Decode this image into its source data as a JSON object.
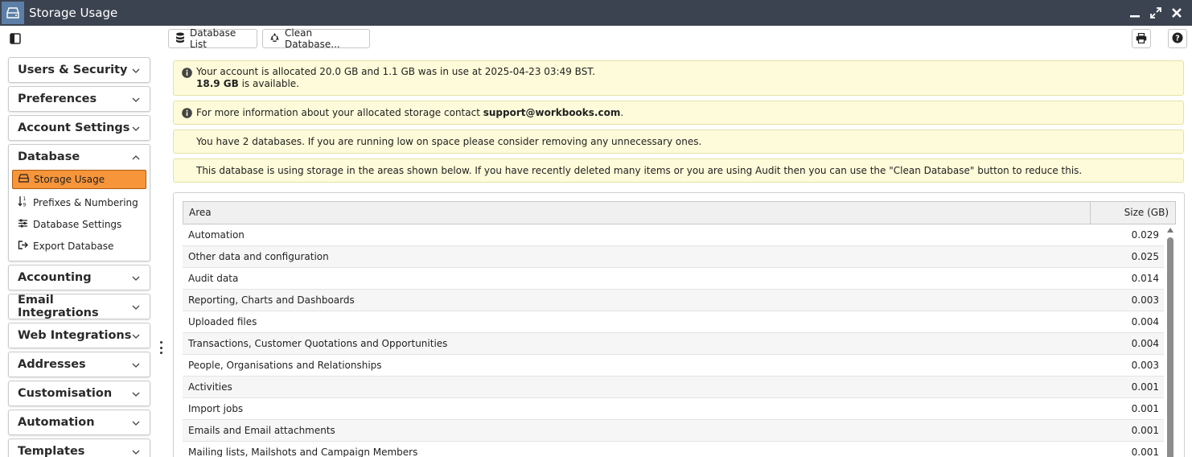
{
  "window": {
    "title": "Storage Usage",
    "icon": "hard-drive-icon",
    "controls": [
      "minimize-icon",
      "maximize-icon",
      "close-icon"
    ]
  },
  "toolbar": {
    "database_list_label": "Database List",
    "clean_database_label": "Clean Database..."
  },
  "sidebar": {
    "sections": [
      {
        "label": "Users & Security",
        "expanded": false
      },
      {
        "label": "Preferences",
        "expanded": false
      },
      {
        "label": "Account Settings",
        "expanded": false
      },
      {
        "label": "Database",
        "expanded": true,
        "items": [
          {
            "label": "Storage Usage",
            "icon": "hard-drive-icon",
            "active": true
          },
          {
            "label": "Prefixes & Numbering",
            "icon": "sort-numeric-icon"
          },
          {
            "label": "Database Settings",
            "icon": "sliders-icon"
          },
          {
            "label": "Export Database",
            "icon": "export-icon"
          }
        ]
      },
      {
        "label": "Accounting",
        "expanded": false
      },
      {
        "label": "Email Integrations",
        "expanded": false
      },
      {
        "label": "Web Integrations",
        "expanded": false
      },
      {
        "label": "Addresses",
        "expanded": false
      },
      {
        "label": "Customisation",
        "expanded": false
      },
      {
        "label": "Automation",
        "expanded": false
      },
      {
        "label": "Templates",
        "expanded": false
      }
    ]
  },
  "notices": {
    "allocation_line1": "Your account is allocated 20.0 GB and 1.1 GB was in use at 2025-04-23 03:49 BST.",
    "available_amount": "18.9 GB",
    "available_suffix": " is available.",
    "contact_prefix": "For more information about your allocated storage contact ",
    "contact_email": "support@workbooks.com",
    "contact_suffix": ".",
    "databases": "You have 2 databases. If you are running low on space please consider removing any unnecessary ones.",
    "usage": "This database is using storage in the areas shown below. If you have recently deleted many items or you are using Audit then you can use the \"Clean Database\" button to reduce this."
  },
  "table": {
    "columns": {
      "area": "Area",
      "size": "Size (GB)"
    },
    "rows": [
      {
        "area": "Automation",
        "size": "0.029"
      },
      {
        "area": "Other data and configuration",
        "size": "0.025"
      },
      {
        "area": "Audit data",
        "size": "0.014"
      },
      {
        "area": "Reporting, Charts and Dashboards",
        "size": "0.003"
      },
      {
        "area": "Uploaded files",
        "size": "0.004"
      },
      {
        "area": "Transactions, Customer Quotations and Opportunities",
        "size": "0.004"
      },
      {
        "area": "People, Organisations and Relationships",
        "size": "0.003"
      },
      {
        "area": "Activities",
        "size": "0.001"
      },
      {
        "area": "Import jobs",
        "size": "0.001"
      },
      {
        "area": "Emails and Email attachments",
        "size": "0.001"
      },
      {
        "area": "Mailing lists, Mailshots and Campaign Members",
        "size": "0.001"
      }
    ]
  },
  "colors": {
    "titlebar": "#3b4350",
    "active_item": "#f7953b",
    "notice_bg": "#fdfbd9"
  }
}
